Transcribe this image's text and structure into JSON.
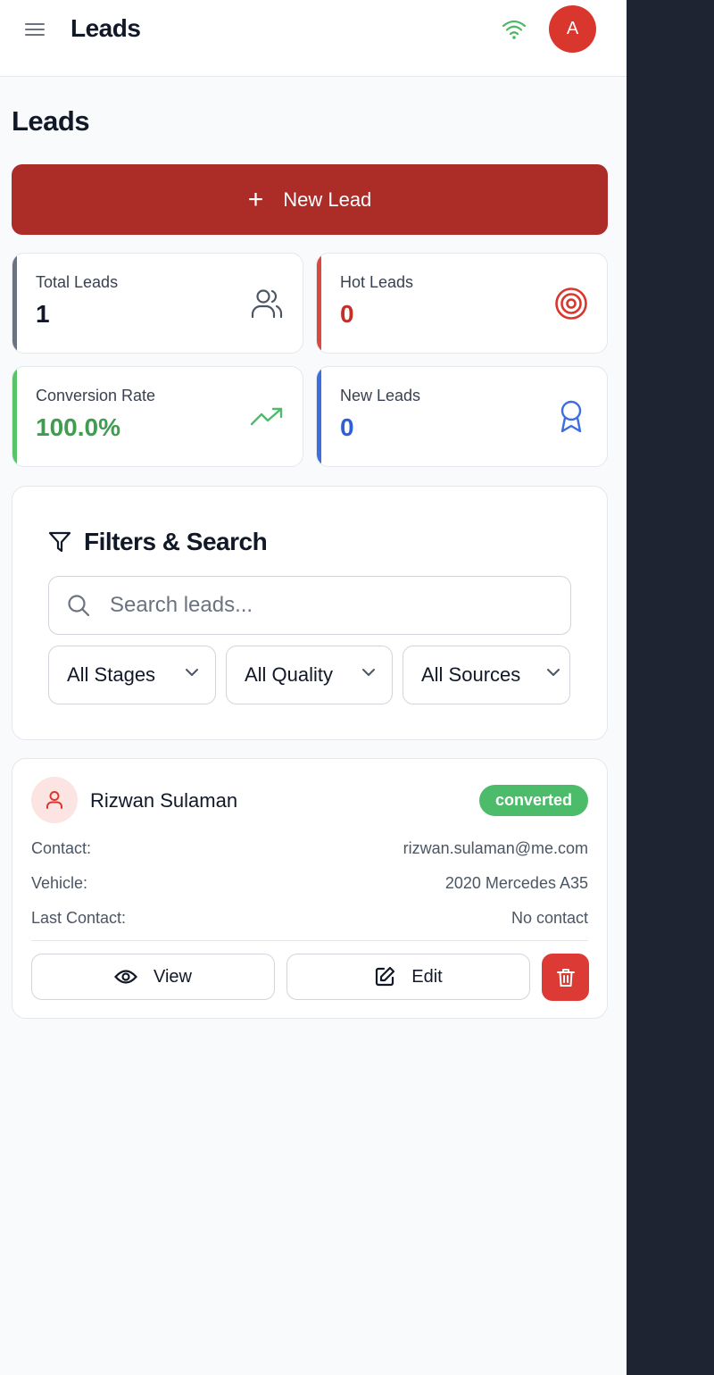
{
  "header": {
    "title": "Leads",
    "avatar_initial": "A"
  },
  "page": {
    "heading": "Leads",
    "new_lead_label": "New Lead"
  },
  "stats": [
    {
      "label": "Total Leads",
      "value": "1",
      "color": "#111827",
      "accent": "#6b7280",
      "icon": "users-icon"
    },
    {
      "label": "Hot Leads",
      "value": "0",
      "color": "#c62f28",
      "accent": "#d9493f",
      "icon": "target-icon"
    },
    {
      "label": "Conversion Rate",
      "value": "100.0%",
      "color": "#3f9d4f",
      "accent": "#59c36a",
      "icon": "trending-up-icon"
    },
    {
      "label": "New Leads",
      "value": "0",
      "color": "#2f5fd6",
      "accent": "#3b6fe0",
      "icon": "award-icon"
    }
  ],
  "filters": {
    "title": "Filters & Search",
    "search_placeholder": "Search leads...",
    "stage": "All Stages",
    "quality": "All Quality",
    "source": "All Sources"
  },
  "leads": [
    {
      "name": "Rizwan Sulaman",
      "status": "converted",
      "fields": [
        {
          "label": "Contact:",
          "value": "rizwan.sulaman@me.com"
        },
        {
          "label": "Vehicle:",
          "value": "2020 Mercedes A35"
        },
        {
          "label": "Last Contact:",
          "value": "No contact"
        }
      ],
      "view_label": "View",
      "edit_label": "Edit"
    }
  ]
}
